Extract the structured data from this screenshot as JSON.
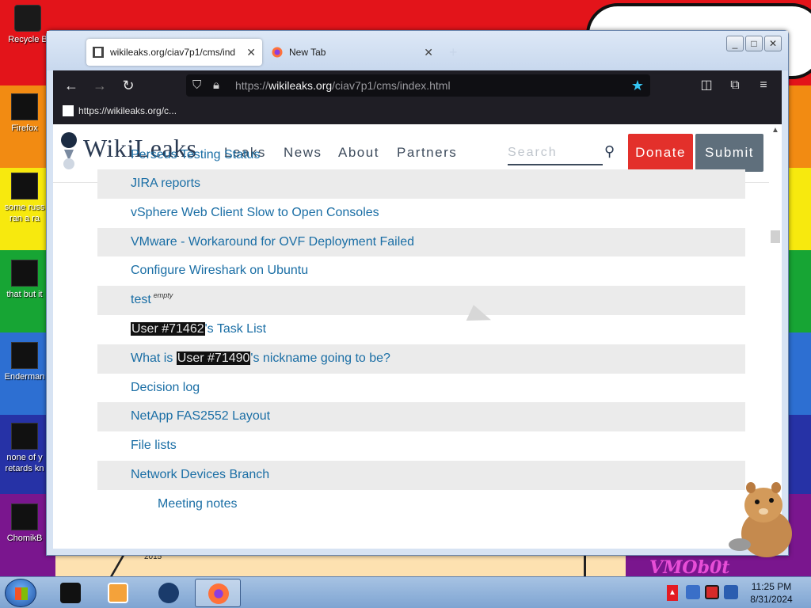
{
  "desktop": {
    "icons": [
      {
        "label": "Recycle B"
      },
      {
        "label": "Firefox"
      },
      {
        "label": "some russ ran a ra"
      },
      {
        "label": "that but it"
      },
      {
        "label": "Enderman"
      },
      {
        "label": "none of y retards kn"
      },
      {
        "label": "ChomikB"
      }
    ],
    "wallpaper_text": "VMOb0t",
    "wallpaper_year": "2015"
  },
  "browser": {
    "tabs": [
      {
        "label": "wikileaks.org/ciav7p1/cms/ind",
        "active": true
      },
      {
        "label": "New Tab",
        "active": false
      }
    ],
    "window_controls": [
      "_",
      "□",
      "✕"
    ],
    "url": {
      "prefix": "https://",
      "domain": "wikileaks.org",
      "path": "/ciav7p1/cms/index.html"
    },
    "bookmark": "https://wikileaks.org/c..."
  },
  "site": {
    "title": "WikiLeaks",
    "nav": [
      "Leaks",
      "News",
      "About",
      "Partners"
    ],
    "search_placeholder": "Search",
    "donate_label": "Donate",
    "submit_label": "Submit"
  },
  "list": {
    "partial_top": "Perseus Testing Status",
    "items": [
      {
        "text": "JIRA reports",
        "shade": true
      },
      {
        "text": "vSphere Web Client Slow to Open Consoles",
        "shade": false
      },
      {
        "text": "VMware - Workaround for OVF Deployment Failed",
        "shade": true
      },
      {
        "text": "Configure Wireshark on Ubuntu",
        "shade": false
      },
      {
        "text": "test",
        "sup": "empty",
        "shade": true
      },
      {
        "redact": "User #71462",
        "after": "'s Task List",
        "shade": false
      },
      {
        "before": "What is ",
        "redact": "User #71490",
        "after": "'s nickname going to be?",
        "shade": true
      },
      {
        "text": "Decision log",
        "shade": false
      },
      {
        "text": "NetApp FAS2552 Layout",
        "shade": true
      },
      {
        "text": "File lists",
        "shade": false
      },
      {
        "text": "Network Devices Branch",
        "shade": true
      },
      {
        "text": "Meeting notes",
        "shade": false,
        "sub": true
      }
    ]
  },
  "taskbar": {
    "time": "11:25 PM",
    "date": "8/31/2024"
  },
  "colors": {
    "link": "#1a6ea5",
    "donate": "#e3302b",
    "submit": "#5f6f7c",
    "star": "#35c6f4",
    "row_shade": "#ebebeb"
  }
}
